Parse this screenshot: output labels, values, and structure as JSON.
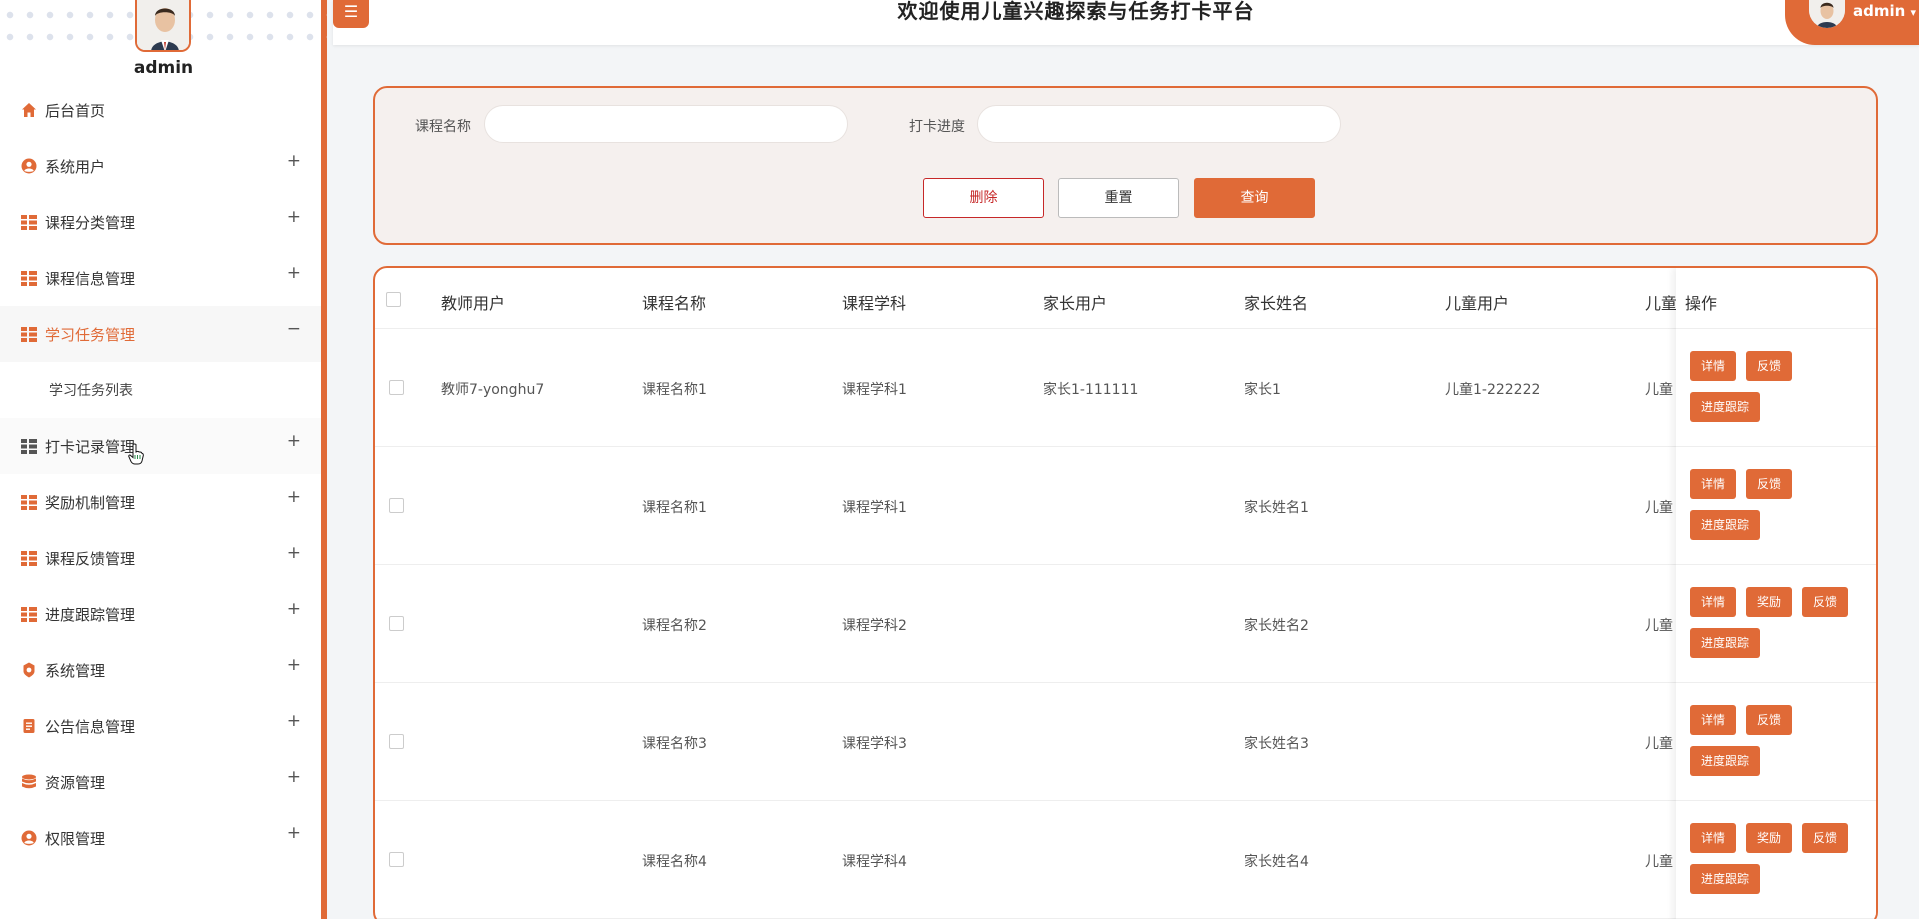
{
  "app": {
    "title": "欢迎使用儿童兴趣探索与任务打卡平台",
    "user": "admin"
  },
  "sidebar": {
    "username": "admin",
    "items": [
      {
        "label": "后台首页",
        "icon": "home-icon",
        "expand": ""
      },
      {
        "label": "系统用户",
        "icon": "user-circle-icon",
        "expand": "+"
      },
      {
        "label": "课程分类管理",
        "icon": "grid-icon",
        "expand": "+"
      },
      {
        "label": "课程信息管理",
        "icon": "grid-icon",
        "expand": "+"
      },
      {
        "label": "学习任务管理",
        "icon": "grid-icon",
        "expand": "−",
        "active": true
      },
      {
        "label": "学习任务列表",
        "sub": true
      },
      {
        "label": "打卡记录管理",
        "icon": "grid-icon",
        "expand": "+"
      },
      {
        "label": "奖励机制管理",
        "icon": "grid-icon",
        "expand": "+"
      },
      {
        "label": "课程反馈管理",
        "icon": "grid-icon",
        "expand": "+"
      },
      {
        "label": "进度跟踪管理",
        "icon": "grid-icon",
        "expand": "+"
      },
      {
        "label": "系统管理",
        "icon": "gear-icon",
        "expand": "+"
      },
      {
        "label": "公告信息管理",
        "icon": "document-icon",
        "expand": "+"
      },
      {
        "label": "资源管理",
        "icon": "database-icon",
        "expand": "+"
      },
      {
        "label": "权限管理",
        "icon": "user-circle-icon",
        "expand": "+"
      }
    ]
  },
  "search": {
    "course_label": "课程名称",
    "course_value": "",
    "progress_label": "打卡进度",
    "progress_value": "",
    "delete_label": "删除",
    "reset_label": "重置",
    "query_label": "查询"
  },
  "table": {
    "columns": [
      "教师用户",
      "课程名称",
      "课程学科",
      "家长用户",
      "家长姓名",
      "儿童用户",
      "儿童",
      "操作"
    ],
    "rows": [
      {
        "teacher": "教师7-yonghu7",
        "course": "课程名称1",
        "subject": "课程学科1",
        "parent_user": "家长1-111111",
        "parent_name": "家长1",
        "child_user": "儿童1-222222",
        "child": "儿童",
        "ops": [
          "详情",
          "反馈",
          "进度跟踪"
        ]
      },
      {
        "teacher": "",
        "course": "课程名称1",
        "subject": "课程学科1",
        "parent_user": "",
        "parent_name": "家长姓名1",
        "child_user": "",
        "child": "儿童",
        "ops": [
          "详情",
          "反馈",
          "进度跟踪"
        ]
      },
      {
        "teacher": "",
        "course": "课程名称2",
        "subject": "课程学科2",
        "parent_user": "",
        "parent_name": "家长姓名2",
        "child_user": "",
        "child": "儿童",
        "ops": [
          "详情",
          "奖励",
          "反馈",
          "进度跟踪"
        ]
      },
      {
        "teacher": "",
        "course": "课程名称3",
        "subject": "课程学科3",
        "parent_user": "",
        "parent_name": "家长姓名3",
        "child_user": "",
        "child": "儿童",
        "ops": [
          "详情",
          "反馈",
          "进度跟踪"
        ]
      },
      {
        "teacher": "",
        "course": "课程名称4",
        "subject": "课程学科4",
        "parent_user": "",
        "parent_name": "家长姓名4",
        "child_user": "",
        "child": "儿童",
        "ops": [
          "详情",
          "奖励",
          "反馈",
          "进度跟踪"
        ]
      }
    ]
  },
  "colors": {
    "accent": "#e06a37",
    "danger": "#c62828",
    "panel_bg": "#f5f0ee"
  }
}
